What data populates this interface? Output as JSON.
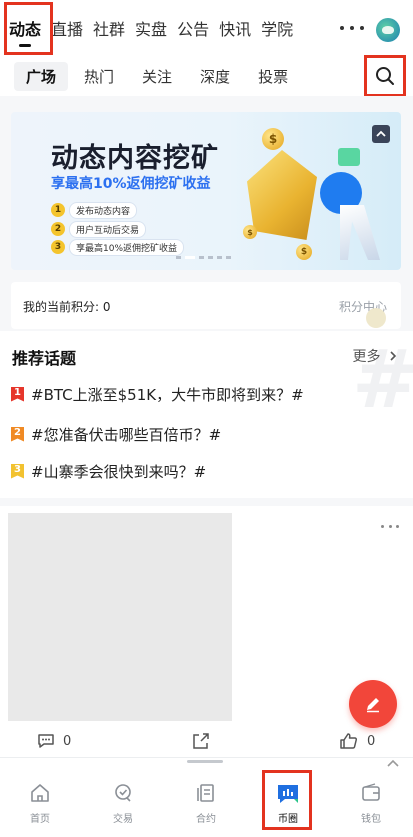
{
  "top_tabs": [
    "动态",
    "直播",
    "社群",
    "实盘",
    "公告",
    "快讯",
    "学院"
  ],
  "sub_tabs": [
    "广场",
    "热门",
    "关注",
    "深度",
    "投票"
  ],
  "banner": {
    "title": "动态内容挖矿",
    "subtitle": "享最高10%返佣挖矿收益",
    "steps": [
      {
        "num": "1",
        "text": "发布动态内容"
      },
      {
        "num": "2",
        "text": "用户互动后交易"
      },
      {
        "num": "3",
        "text": "享最高10%返佣挖矿收益"
      }
    ],
    "coin_symbol": "$"
  },
  "points": {
    "label": "我的当前积分: 0",
    "link": "积分中心"
  },
  "topics": {
    "heading": "推荐话题",
    "more": "更多",
    "watermark": "#",
    "items": [
      {
        "rank": "1",
        "color": "#e6362b",
        "text": "#BTC上涨至$51K，大牛市即将到来？#"
      },
      {
        "rank": "2",
        "color": "#f08a24",
        "text": "#您准备伏击哪些百倍币？#"
      },
      {
        "rank": "3",
        "color": "#f2c230",
        "text": "#山寨季会很快到来吗？#"
      }
    ]
  },
  "post": {
    "comments": "0",
    "likes": "0"
  },
  "bottom_nav": [
    {
      "label": "首页",
      "icon": "home-icon"
    },
    {
      "label": "交易",
      "icon": "trade-icon"
    },
    {
      "label": "合约",
      "icon": "contract-icon"
    },
    {
      "label": "币圈",
      "icon": "community-icon"
    },
    {
      "label": "钱包",
      "icon": "wallet-icon"
    }
  ],
  "colors": {
    "highlight": "#e3331f",
    "accent_blue": "#2c70f0",
    "fab": "#f2463a"
  }
}
